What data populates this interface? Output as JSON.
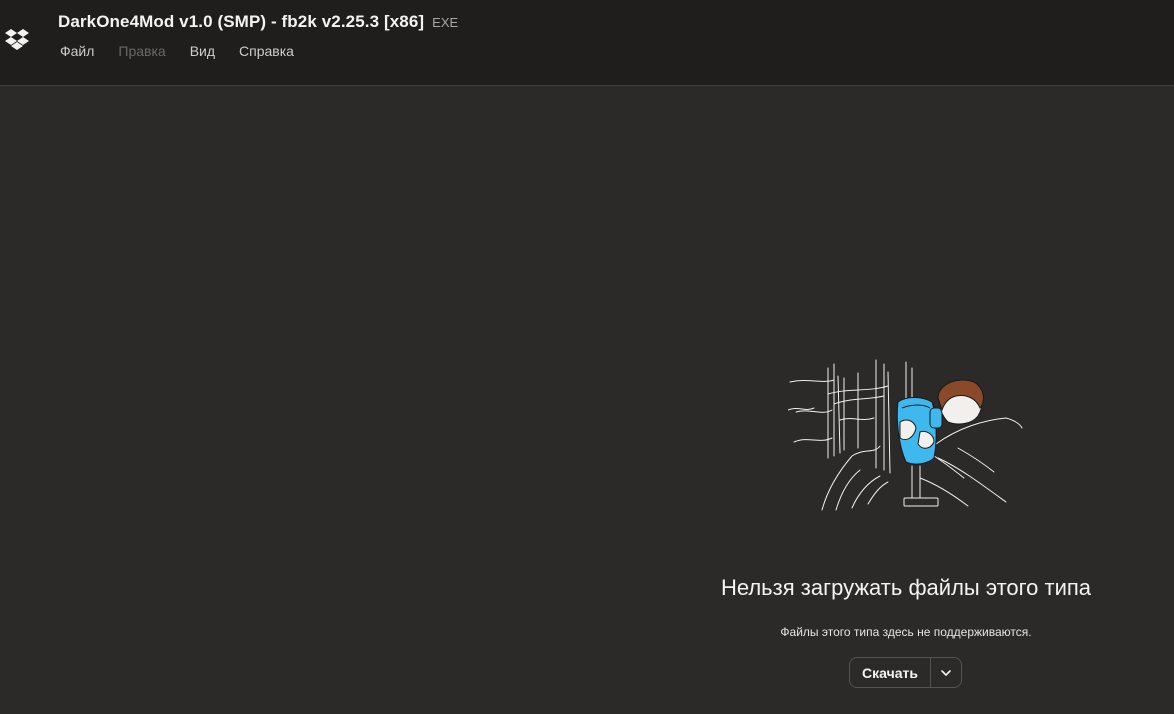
{
  "header": {
    "title": "DarkOne4Mod v1.0 (SMP) - fb2k v2.25.3 [x86]",
    "extension": "EXE",
    "logo_icon": "dropbox-logo-icon"
  },
  "menu": {
    "items": [
      {
        "label": "Файл",
        "enabled": true
      },
      {
        "label": "Правка",
        "enabled": false
      },
      {
        "label": "Вид",
        "enabled": true
      },
      {
        "label": "Справка",
        "enabled": true
      }
    ]
  },
  "message": {
    "title": "Нельзя загружать файлы этого типа",
    "subtitle": "Файлы этого типа здесь не поддерживаются.",
    "illustration": "person-looking-through-binoculars"
  },
  "download": {
    "label": "Скачать",
    "caret_icon": "chevron-down-icon"
  },
  "colors": {
    "background": "#2b2a28",
    "header": "#1f1e1d",
    "accent": "#3fb8ee"
  }
}
